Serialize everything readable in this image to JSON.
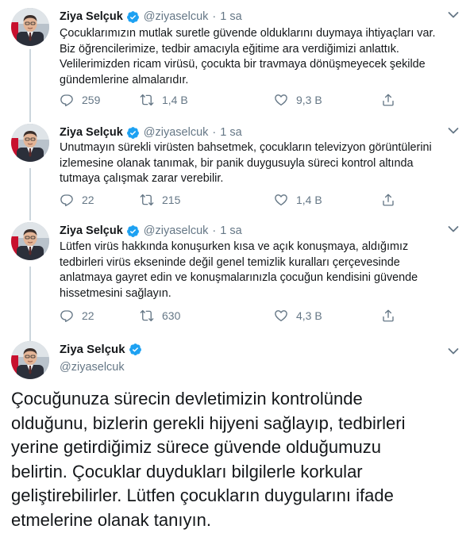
{
  "author": {
    "name": "Ziya Selçuk",
    "handle": "@ziyaselcuk",
    "verified": true,
    "verified_icon": "verified-badge-icon"
  },
  "tweets": [
    {
      "time": "1 sa",
      "lines": [
        "Çocuklarımızın mutlak suretle güvende olduklarını duymaya ihtiyaçları var.",
        "Biz öğrencilerimize, tedbir amacıyla eğitime ara verdiğimizi anlattık.",
        "Velilerimizden ricam virüsü, çocukta bir travmaya dönüşmeyecek şekilde",
        "gündemlerine almalarıdır."
      ],
      "replies": "259",
      "retweets": "1,4 B",
      "likes": "9,3 B"
    },
    {
      "time": "1 sa",
      "lines": [
        "Unutmayın sürekli virüsten bahsetmek, çocukların televizyon görüntülerini",
        "izlemesine olanak tanımak, bir panik duygusuyla süreci kontrol altında",
        "tutmaya çalışmak zarar verebilir."
      ],
      "replies": "22",
      "retweets": "215",
      "likes": "1,4 B"
    },
    {
      "time": "1 sa",
      "lines": [
        "Lütfen virüs hakkında konuşurken kısa ve açık konuşmaya, aldığımız",
        "tedbirleri virüs ekseninde değil genel temizlik kuralları çerçevesinde",
        "anlatmaya gayret edin ve konuşmalarınızla çocuğun kendisini güvende",
        "hissetmesini sağlayın."
      ],
      "replies": "22",
      "retweets": "630",
      "likes": "4,3 B"
    }
  ],
  "main_tweet": {
    "lines": [
      "Çocuğunuza sürecin devletimizin kontrolünde",
      "olduğunu, bizlerin gerekli hijyeni sağlayıp, tedbirleri",
      "yerine getirdiğimiz sürece güvende olduğumuzu",
      "belirtin. Çocuklar duydukları bilgilerle korkular",
      "geliştirebilirler. Lütfen çocukların duygularını ifade",
      "etmelerine olanak tanıyın."
    ]
  },
  "icons": {
    "reply": "reply-icon",
    "retweet": "retweet-icon",
    "like": "heart-icon",
    "share": "share-icon",
    "caret": "chevron-down-icon"
  },
  "colors": {
    "text": "#14171a",
    "muted": "#657786",
    "verified": "#1da1f2",
    "divider": "#e6ecf0"
  }
}
